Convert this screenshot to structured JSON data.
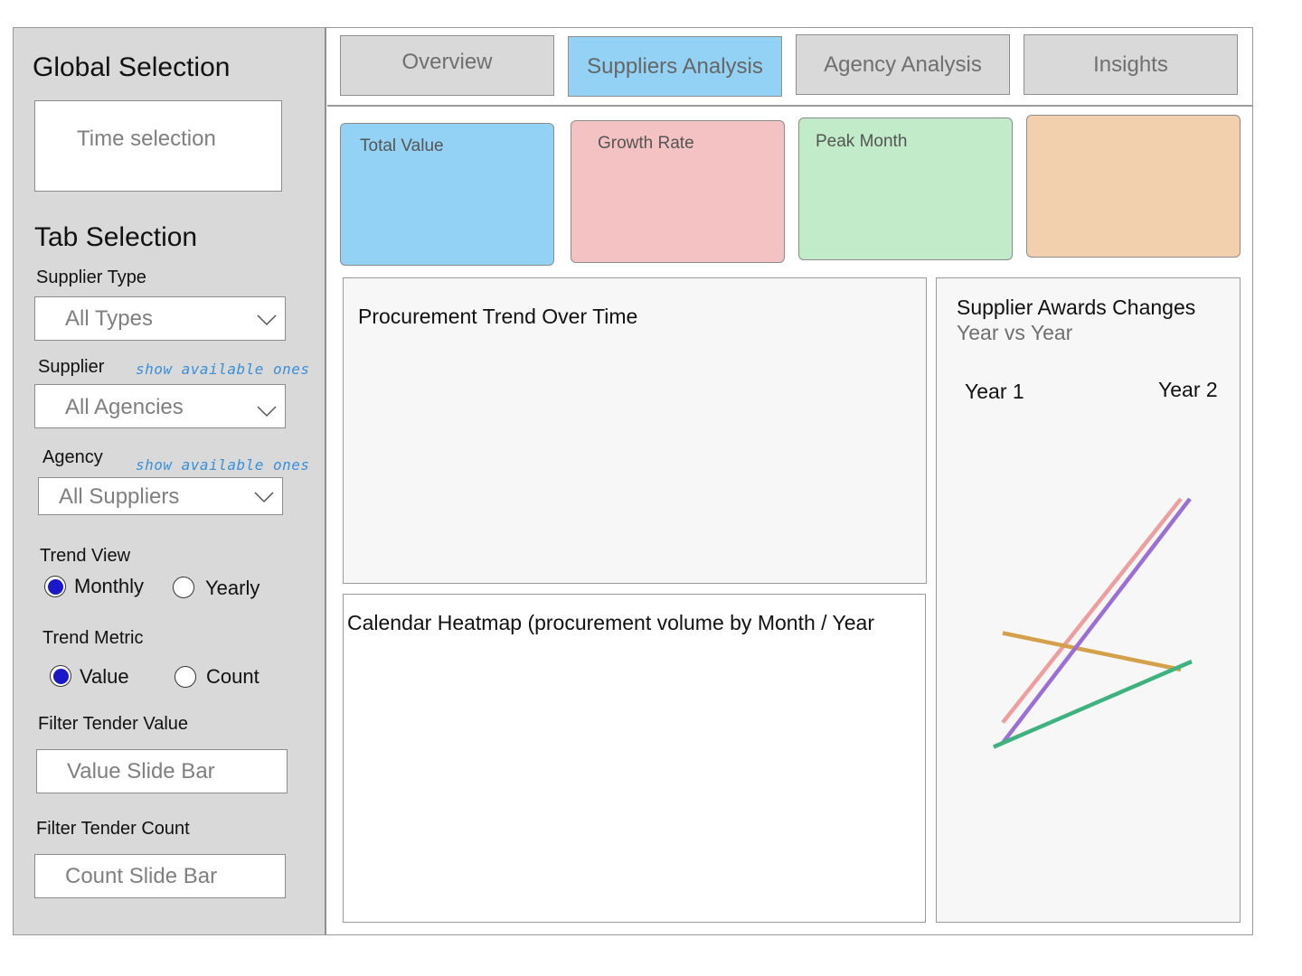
{
  "sidebar": {
    "global_title": "Global Selection",
    "time_selection": "Time selection",
    "tab_title": "Tab Selection",
    "supplier_type_label": "Supplier Type",
    "supplier_type_value": "All Types",
    "supplier_label": "Supplier",
    "supplier_value": "All Agencies",
    "agency_label": "Agency",
    "agency_value": "All Suppliers",
    "show_available": "show available ones",
    "trend_view_label": "Trend View",
    "trend_view_options": [
      "Monthly",
      "Yearly"
    ],
    "trend_view_selected": "Monthly",
    "trend_metric_label": "Trend Metric",
    "trend_metric_options": [
      "Value",
      "Count"
    ],
    "trend_metric_selected": "Value",
    "filter_value_label": "Filter Tender Value",
    "filter_value_placeholder": "Value Slide Bar",
    "filter_count_label": "Filter Tender Count",
    "filter_count_placeholder": "Count Slide Bar"
  },
  "tabs": [
    {
      "label": "Overview",
      "active": false
    },
    {
      "label": "Suppliers Analysis",
      "active": true
    },
    {
      "label": "Agency Analysis",
      "active": false
    },
    {
      "label": "Insights",
      "active": false
    }
  ],
  "kpis": [
    {
      "label": "Total Value",
      "color": "#93d2f5"
    },
    {
      "label": "Growth Rate",
      "color": "#f4c2c2"
    },
    {
      "label": "Peak Month",
      "color": "#c2ebc9"
    },
    {
      "label": "",
      "color": "#f2cfad"
    }
  ],
  "panels": {
    "trend_title": "Procurement Trend Over Time",
    "heatmap_title": "Calendar Heatmap (procurement volume by Month / Year",
    "awards_title": "Supplier Awards Changes",
    "awards_subtitle": "Year vs Year",
    "awards_year1": "Year 1",
    "awards_year2": "Year 2"
  },
  "chart_data": {
    "type": "line",
    "x": [
      "Year 1",
      "Year 2"
    ],
    "series": [
      {
        "color": "#ee9e9e",
        "values": [
          0.33,
          0.88
        ]
      },
      {
        "color": "#d4a04a",
        "values": [
          0.55,
          0.46
        ]
      },
      {
        "color": "#9b6fd6",
        "values": [
          0.28,
          0.88
        ]
      },
      {
        "color": "#3fb37f",
        "values": [
          0.27,
          0.48
        ]
      }
    ]
  }
}
